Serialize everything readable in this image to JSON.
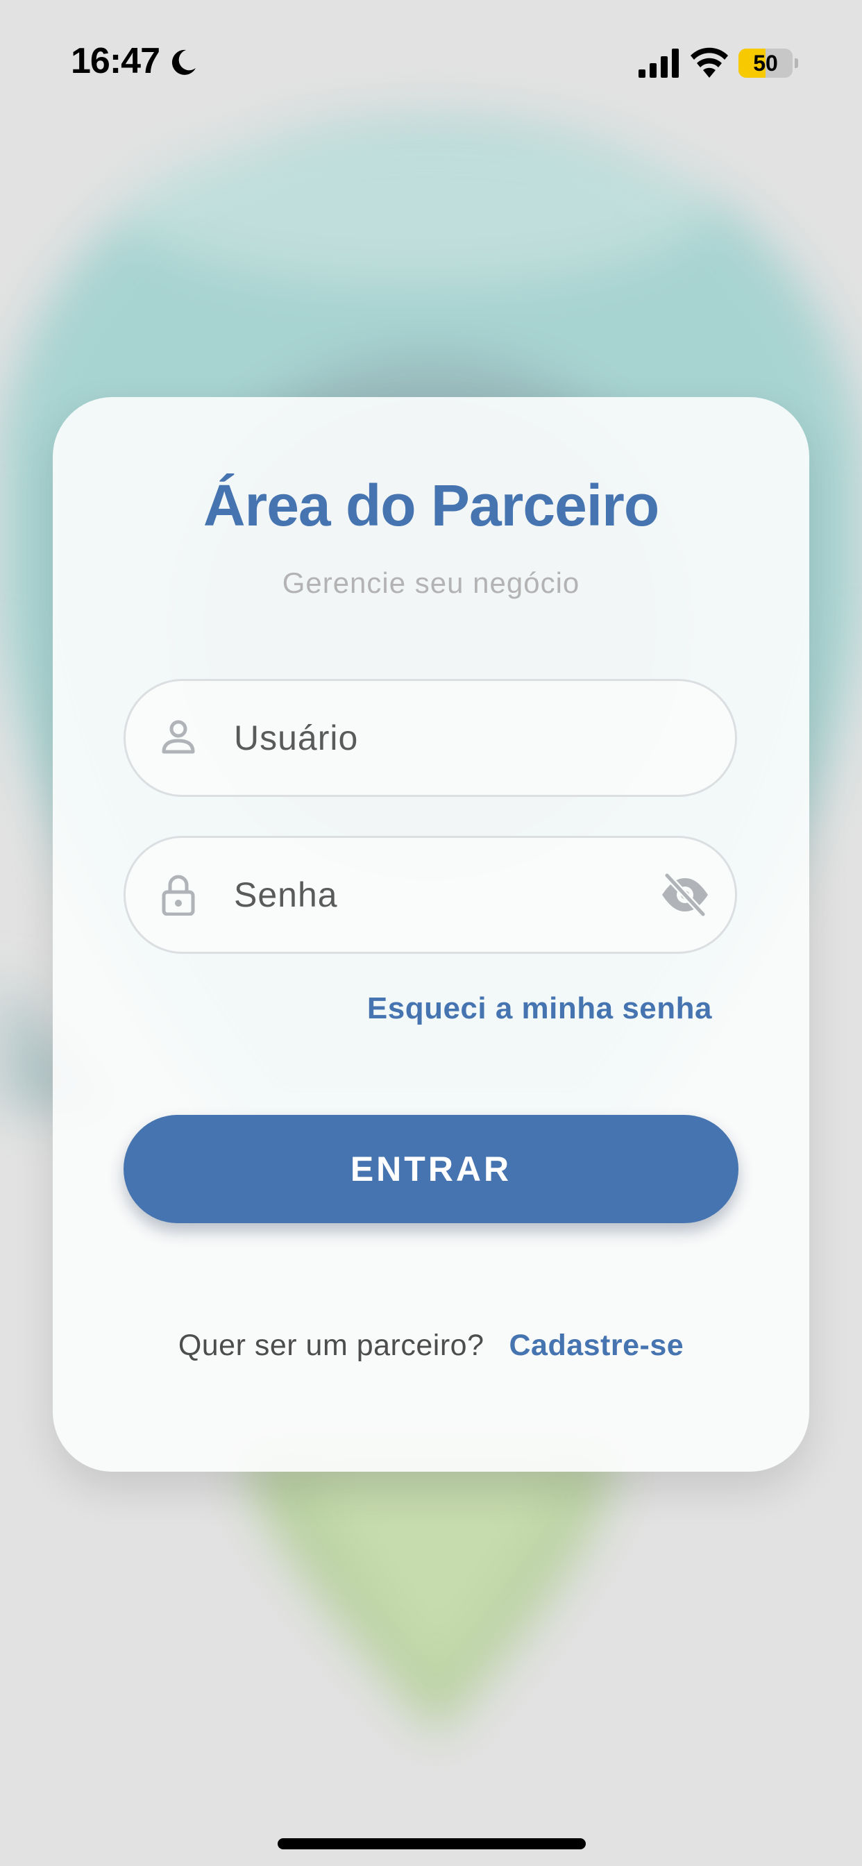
{
  "status_bar": {
    "time": "16:47",
    "battery_level": 50,
    "battery_label": "50",
    "icons": [
      "moon-icon",
      "signal-icon",
      "wifi-icon",
      "battery-icon"
    ]
  },
  "login_card": {
    "title": "Área do Parceiro",
    "subtitle": "Gerencie seu negócio",
    "username_field": {
      "placeholder": "Usuário",
      "icon": "user-icon"
    },
    "password_field": {
      "placeholder": "Senha",
      "icon": "lock-icon",
      "toggle_icon": "eye-slash-icon"
    },
    "forgot_password_label": "Esqueci a minha senha",
    "submit_label": "ENTRAR",
    "signup_prompt": "Quer ser um parceiro?",
    "signup_link_label": "Cadastre-se"
  },
  "colors": {
    "accent": "#4574b0",
    "background": "#e2e2e2",
    "card": "#fcfdfd",
    "subtitle": "#b3b3b3",
    "battery_fill": "#f7c900"
  }
}
